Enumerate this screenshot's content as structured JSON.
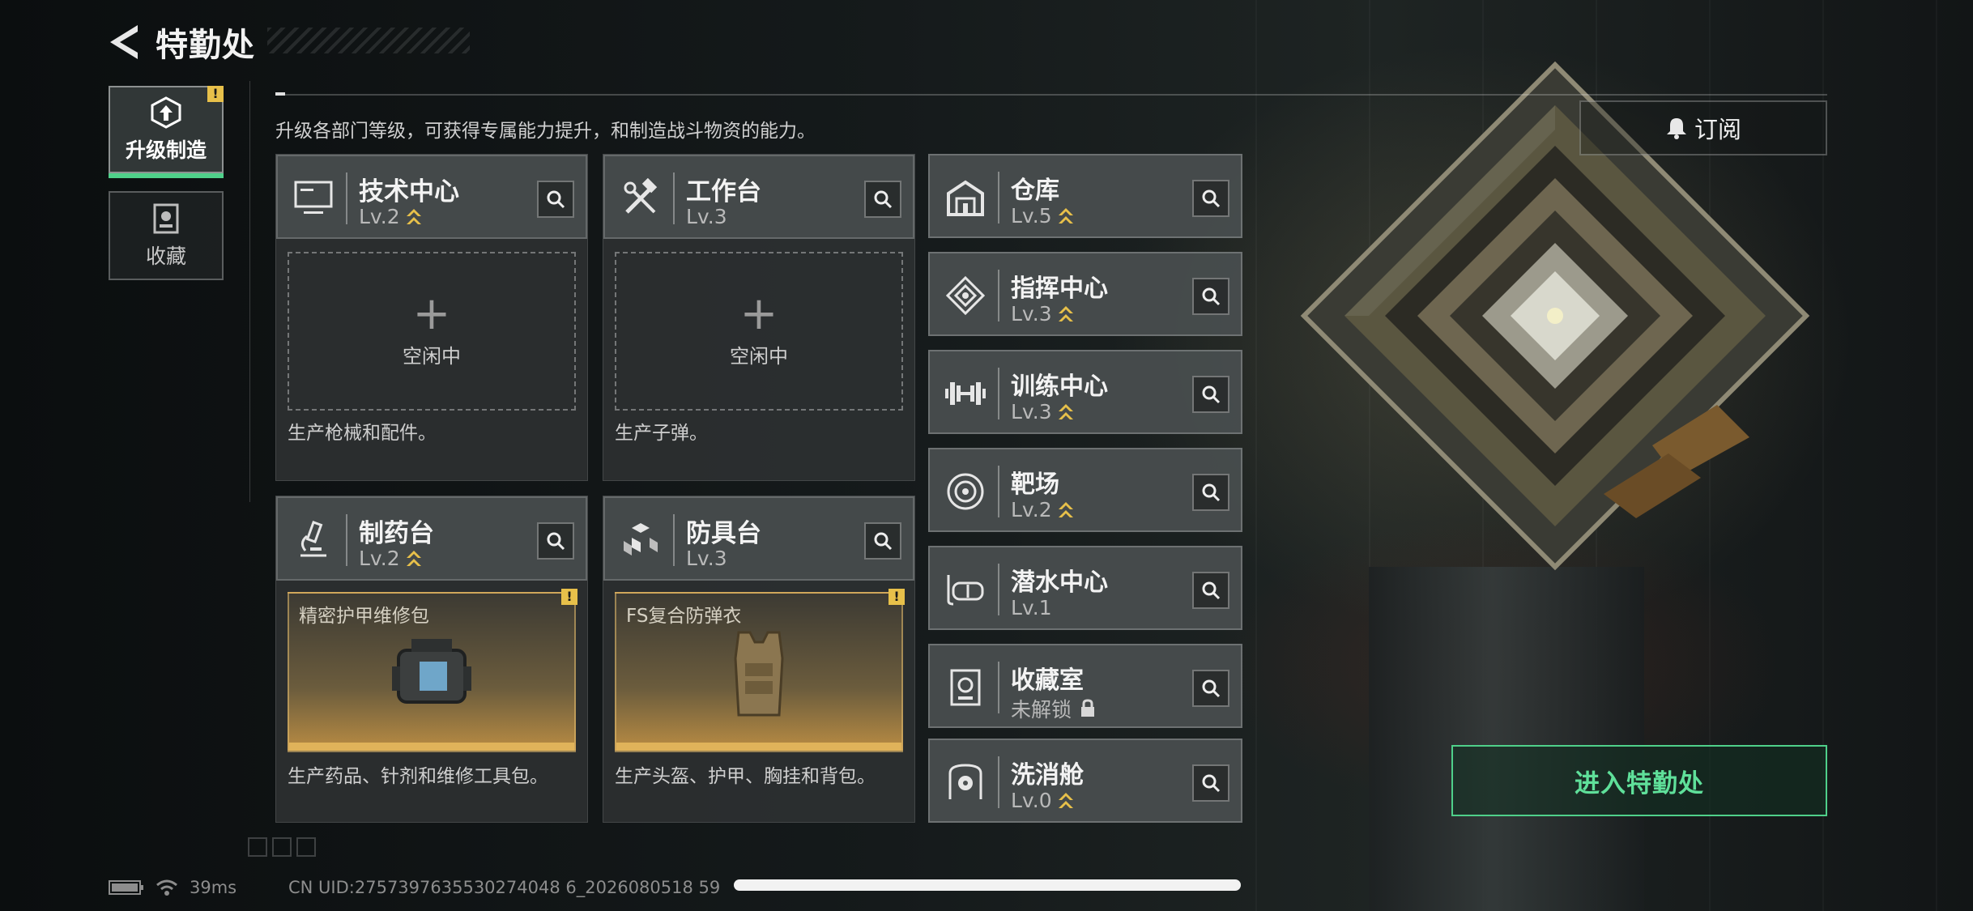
{
  "header": {
    "title": "特勤处"
  },
  "subtitle": "升级各部门等级，可获得专属能力提升，和制造战斗物资的能力。",
  "side_tabs": [
    {
      "label": "升级制造",
      "active": true,
      "alert": "!"
    },
    {
      "label": "收藏",
      "active": false
    }
  ],
  "panels": {
    "tech": {
      "name": "技术中心",
      "level": "Lv.2",
      "slot": {
        "plus": "+",
        "text": "空闲中"
      },
      "desc": "生产枪械和配件。"
    },
    "workbench": {
      "name": "工作台",
      "level": "Lv.3",
      "slot": {
        "plus": "+",
        "text": "空闲中"
      },
      "desc": "生产子弹。"
    },
    "pharmacy": {
      "name": "制药台",
      "level": "Lv.2",
      "craft": {
        "name": "精密护甲维修包",
        "alert": "!"
      },
      "desc": "生产药品、针剂和维修工具包。"
    },
    "armor": {
      "name": "防具台",
      "level": "Lv.3",
      "craft": {
        "name": "FS复合防弹衣",
        "alert": "!"
      },
      "desc": "生产头盔、护甲、胸挂和背包。"
    }
  },
  "facilities": [
    {
      "name": "仓库",
      "level": "Lv.5",
      "upgradable": true,
      "icon": "warehouse-icon"
    },
    {
      "name": "指挥中心",
      "level": "Lv.3",
      "upgradable": true,
      "icon": "command-center-icon"
    },
    {
      "name": "训练中心",
      "level": "Lv.3",
      "upgradable": true,
      "icon": "dumbbell-icon"
    },
    {
      "name": "靶场",
      "level": "Lv.2",
      "upgradable": true,
      "icon": "target-icon"
    },
    {
      "name": "潜水中心",
      "level": "Lv.1",
      "upgradable": false,
      "icon": "diving-mask-icon"
    },
    {
      "name": "收藏室",
      "level": "未解锁",
      "locked": true,
      "icon": "collection-room-icon"
    },
    {
      "name": "洗消舱",
      "level": "Lv.0",
      "upgradable": true,
      "icon": "decontamination-icon"
    }
  ],
  "subscribe": {
    "label": "订阅"
  },
  "enter": {
    "label": "进入特勤处"
  },
  "status": {
    "ping": "39ms",
    "uid": "CN UID:2757397635530274048 6_2026080518 59"
  },
  "colors": {
    "accent_green": "#4fd08a",
    "rank_gold": "#e7c04a",
    "alert_yellow": "#e7c04a"
  }
}
